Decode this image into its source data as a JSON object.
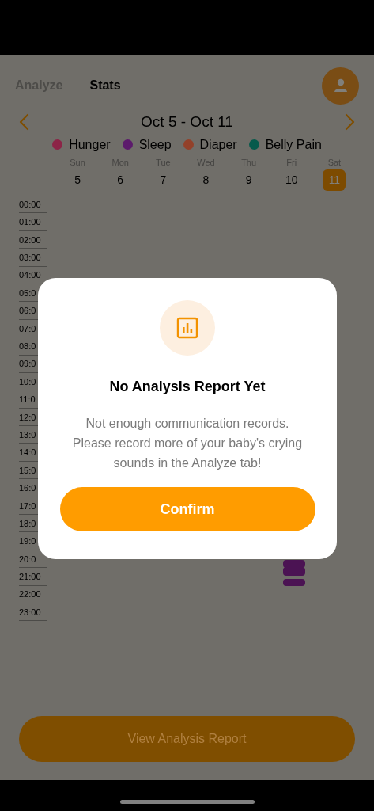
{
  "tabs": [
    {
      "label": "Analyze",
      "selected": false
    },
    {
      "label": "Stats",
      "selected": true
    }
  ],
  "week": {
    "range": "Oct 5 - Oct 11"
  },
  "legend": [
    {
      "label": "Hunger",
      "color": "#8c2447"
    },
    {
      "label": "Sleep",
      "color": "#5c1a6c"
    },
    {
      "label": "Diaper",
      "color": "#93412a"
    },
    {
      "label": "Belly Pain",
      "color": "#075a4c"
    }
  ],
  "days": [
    {
      "weekday": "Sun",
      "date": "5",
      "selected": false
    },
    {
      "weekday": "Mon",
      "date": "6",
      "selected": false
    },
    {
      "weekday": "Tue",
      "date": "7",
      "selected": false
    },
    {
      "weekday": "Wed",
      "date": "8",
      "selected": false
    },
    {
      "weekday": "Thu",
      "date": "9",
      "selected": false
    },
    {
      "weekday": "Fri",
      "date": "10",
      "selected": false
    },
    {
      "weekday": "Sat",
      "date": "11",
      "selected": true
    }
  ],
  "hours": [
    "00:00",
    "01:00",
    "02:00",
    "03:00",
    "04:00",
    "05:0",
    "06:0",
    "07:0",
    "08:0",
    "09:0",
    "10:0",
    "11:0",
    "12:0",
    "13:0",
    "14:0",
    "15:0",
    "16:0",
    "17:0",
    "18:0",
    "19:0",
    "20:0",
    "21:00",
    "22:00",
    "23:00"
  ],
  "entries": [
    {
      "color": "#4b1353"
    },
    {
      "color": "#4b1353"
    },
    {
      "color": "#4b1353"
    }
  ],
  "dialog": {
    "title": "No Analysis Report Yet",
    "message": "Not enough communication records. Please record more of your baby's crying sounds in the Analyze tab!",
    "button": "Confirm"
  },
  "report_button": "View Analysis Report"
}
